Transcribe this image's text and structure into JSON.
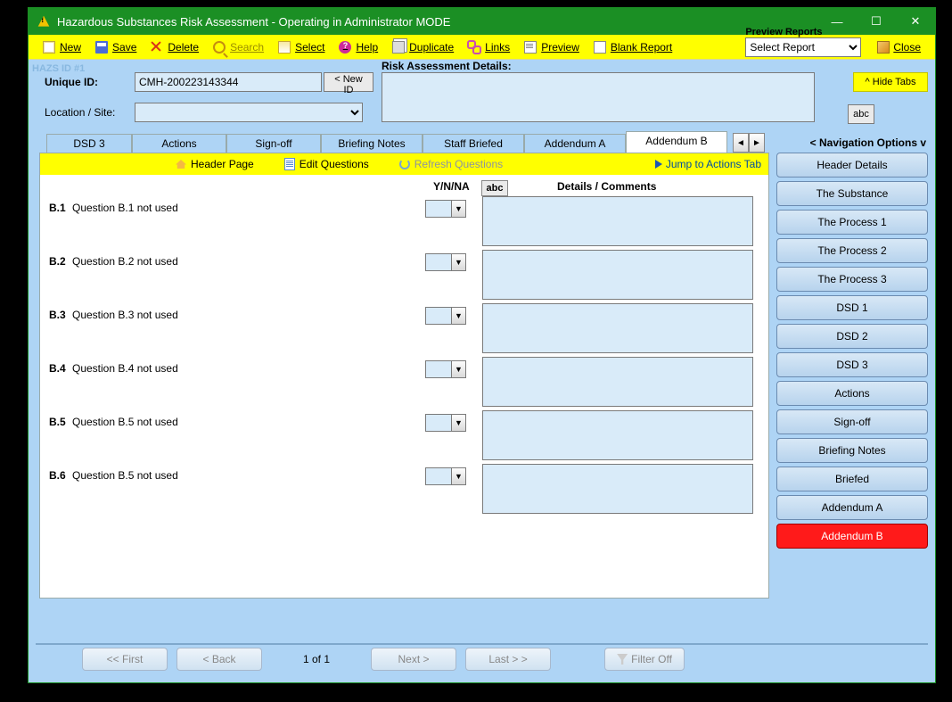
{
  "title": "Hazardous Substances Risk Assessment - Operating in Administrator MODE",
  "toolbar": {
    "new": "New",
    "save": "Save",
    "delete": "Delete",
    "search": "Search",
    "select": "Select",
    "help": "Help",
    "duplicate": "Duplicate",
    "links": "Links",
    "preview": "Preview",
    "blank": "Blank Report",
    "reports_label": "Preview Reports",
    "reports_value": "Select Report",
    "close": "Close"
  },
  "header": {
    "hazsid": "HAZS ID #1",
    "unique_id_label": "Unique ID:",
    "unique_id_value": "CMH-200223143344",
    "newid_btn": "< New ID",
    "location_label": "Location / Site:",
    "location_value": "",
    "risk_label": "Risk Assessment Details:",
    "hide_tabs": "^ Hide Tabs",
    "abc": "abc"
  },
  "tabs": {
    "visible": [
      "DSD 3",
      "Actions",
      "Sign-off",
      "Briefing Notes",
      "Staff Briefed",
      "Addendum A",
      "Addendum B"
    ],
    "active_index": 6,
    "nav_options": "< Navigation Options v"
  },
  "workbar": {
    "header_page": "Header Page",
    "edit_questions": "Edit Questions",
    "refresh_questions": "Refresh Questions",
    "jump": "Jump to Actions Tab"
  },
  "columns": {
    "ynna": "Y/N/NA",
    "abc": "abc",
    "details": "Details / Comments"
  },
  "questions": [
    {
      "num": "B.1",
      "text": "Question B.1 not used"
    },
    {
      "num": "B.2",
      "text": "Question B.2 not used"
    },
    {
      "num": "B.3",
      "text": "Question B.3 not used"
    },
    {
      "num": "B.4",
      "text": "Question B.4 not used"
    },
    {
      "num": "B.5",
      "text": "Question B.5 not used"
    },
    {
      "num": "B.6",
      "text": "Question B.5 not used"
    }
  ],
  "sidenav": [
    "Header Details",
    "The Substance",
    "The Process 1",
    "The Process 2",
    "The Process 3",
    "DSD 1",
    "DSD 2",
    "DSD 3",
    "Actions",
    "Sign-off",
    "Briefing Notes",
    "Briefed",
    "Addendum A",
    "Addendum B"
  ],
  "sidenav_active": 13,
  "footer": {
    "first": "<<  First",
    "back": "<  Back",
    "page": "1 of 1",
    "next": "Next  >",
    "last": "Last  > >",
    "filter": "Filter Off"
  }
}
